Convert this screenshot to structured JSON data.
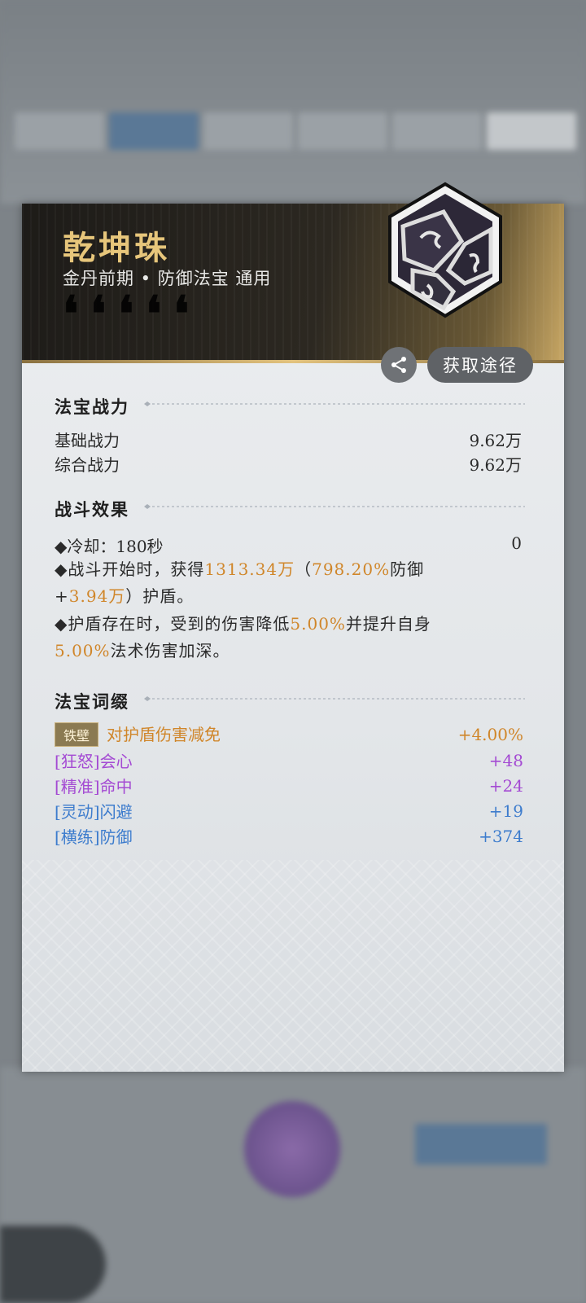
{
  "item": {
    "name": "乾坤珠",
    "subtitle": "金丹前期 • 防御法宝 通用"
  },
  "actions": {
    "source_label": "获取途径"
  },
  "power": {
    "title": "法宝战力",
    "rows": [
      {
        "label": "基础战力",
        "value": "9.62万"
      },
      {
        "label": "综合战力",
        "value": "9.62万"
      }
    ]
  },
  "effects": {
    "title": "战斗效果",
    "cooldown_label": "◆冷却：180秒",
    "cooldown_value": "0",
    "line2": {
      "a": "◆战斗开始时，获得",
      "b": "1313.34万",
      "c": "（",
      "d": "798.20%",
      "e": "防御",
      "f": "+",
      "g": "3.94万",
      "h": "）护盾。"
    },
    "line3": {
      "a": "◆护盾存在时，受到的伤害降低",
      "b": "5.00%",
      "c": "并提升自身",
      "d": "5.00%",
      "e": "法术伤害加深。"
    }
  },
  "affixes": {
    "title": "法宝词缀",
    "items": [
      {
        "tag": "铁壁",
        "label": "对护盾伤害减免",
        "value": "+4.00%",
        "color": "#d0862a"
      },
      {
        "label": "[狂怒]会心",
        "value": "+48",
        "color": "#a44ad3"
      },
      {
        "label": "[精准]命中",
        "value": "+24",
        "color": "#a44ad3"
      },
      {
        "label": "[灵动]闪避",
        "value": "+19",
        "color": "#3d7ccd"
      },
      {
        "label": "[横练]防御",
        "value": "+374",
        "color": "#3d7ccd"
      }
    ]
  }
}
